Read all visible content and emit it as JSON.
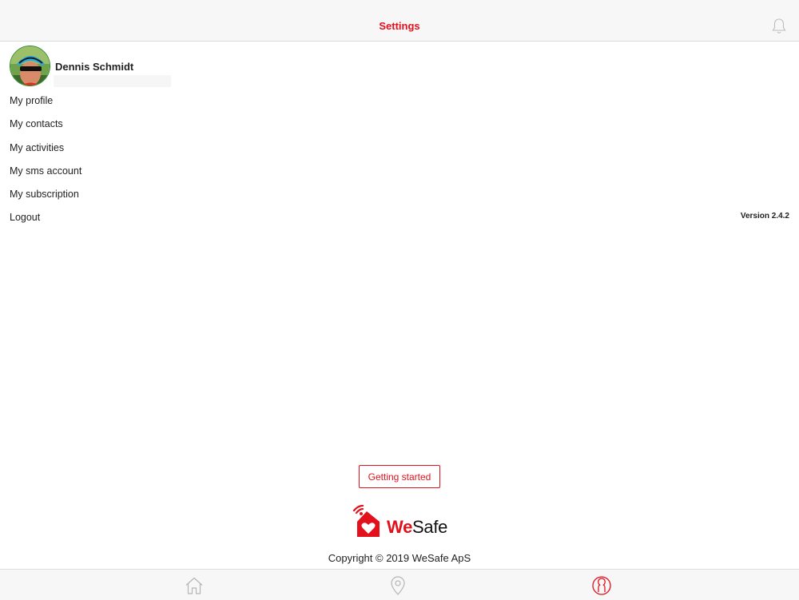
{
  "header": {
    "title": "Settings",
    "notification_icon": "bell-icon"
  },
  "profile": {
    "name": "Dennis Schmidt",
    "subtitle": ""
  },
  "menu": {
    "items": [
      {
        "label": "My profile"
      },
      {
        "label": "My contacts"
      },
      {
        "label": "My activities"
      },
      {
        "label": "My sms account"
      },
      {
        "label": "My subscription"
      },
      {
        "label": "Logout"
      }
    ]
  },
  "version": "Version 2.4.2",
  "getting_started": "Getting started",
  "logo": {
    "brand_we": "We",
    "brand_safe": "Safe"
  },
  "copyright": "Copyright © 2019 WeSafe ApS",
  "tabbar": {
    "tabs": [
      {
        "icon": "home-icon",
        "active": false
      },
      {
        "icon": "location-pin-icon",
        "active": false
      },
      {
        "icon": "profile-icon",
        "active": true
      }
    ]
  },
  "colors": {
    "accent": "#e2111b",
    "inactive_icon": "#b5b5b5",
    "bar_background": "#f7f7f7"
  }
}
